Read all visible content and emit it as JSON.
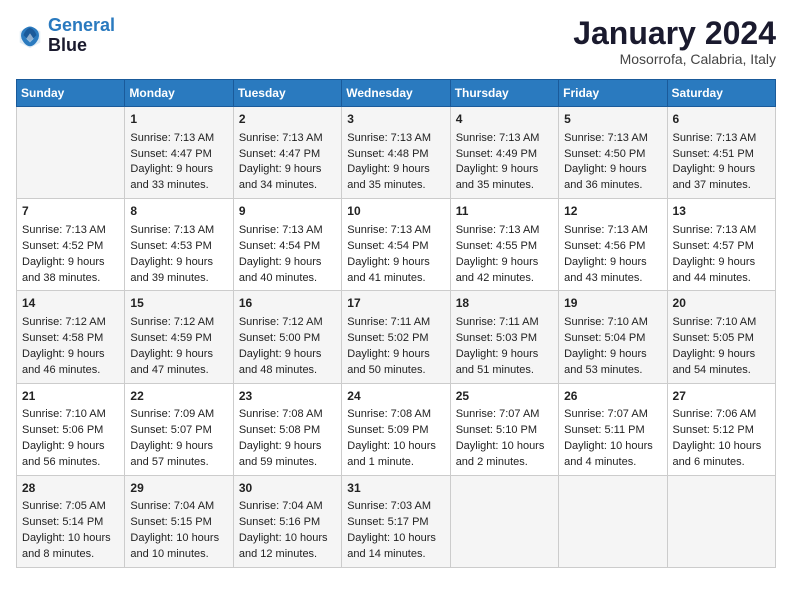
{
  "header": {
    "logo_line1": "General",
    "logo_line2": "Blue",
    "month": "January 2024",
    "location": "Mosorrofa, Calabria, Italy"
  },
  "columns": [
    "Sunday",
    "Monday",
    "Tuesday",
    "Wednesday",
    "Thursday",
    "Friday",
    "Saturday"
  ],
  "weeks": [
    [
      {
        "day": "",
        "sunrise": "",
        "sunset": "",
        "daylight": ""
      },
      {
        "day": "1",
        "sunrise": "Sunrise: 7:13 AM",
        "sunset": "Sunset: 4:47 PM",
        "daylight": "Daylight: 9 hours and 33 minutes."
      },
      {
        "day": "2",
        "sunrise": "Sunrise: 7:13 AM",
        "sunset": "Sunset: 4:47 PM",
        "daylight": "Daylight: 9 hours and 34 minutes."
      },
      {
        "day": "3",
        "sunrise": "Sunrise: 7:13 AM",
        "sunset": "Sunset: 4:48 PM",
        "daylight": "Daylight: 9 hours and 35 minutes."
      },
      {
        "day": "4",
        "sunrise": "Sunrise: 7:13 AM",
        "sunset": "Sunset: 4:49 PM",
        "daylight": "Daylight: 9 hours and 35 minutes."
      },
      {
        "day": "5",
        "sunrise": "Sunrise: 7:13 AM",
        "sunset": "Sunset: 4:50 PM",
        "daylight": "Daylight: 9 hours and 36 minutes."
      },
      {
        "day": "6",
        "sunrise": "Sunrise: 7:13 AM",
        "sunset": "Sunset: 4:51 PM",
        "daylight": "Daylight: 9 hours and 37 minutes."
      }
    ],
    [
      {
        "day": "7",
        "sunrise": "Sunrise: 7:13 AM",
        "sunset": "Sunset: 4:52 PM",
        "daylight": "Daylight: 9 hours and 38 minutes."
      },
      {
        "day": "8",
        "sunrise": "Sunrise: 7:13 AM",
        "sunset": "Sunset: 4:53 PM",
        "daylight": "Daylight: 9 hours and 39 minutes."
      },
      {
        "day": "9",
        "sunrise": "Sunrise: 7:13 AM",
        "sunset": "Sunset: 4:54 PM",
        "daylight": "Daylight: 9 hours and 40 minutes."
      },
      {
        "day": "10",
        "sunrise": "Sunrise: 7:13 AM",
        "sunset": "Sunset: 4:54 PM",
        "daylight": "Daylight: 9 hours and 41 minutes."
      },
      {
        "day": "11",
        "sunrise": "Sunrise: 7:13 AM",
        "sunset": "Sunset: 4:55 PM",
        "daylight": "Daylight: 9 hours and 42 minutes."
      },
      {
        "day": "12",
        "sunrise": "Sunrise: 7:13 AM",
        "sunset": "Sunset: 4:56 PM",
        "daylight": "Daylight: 9 hours and 43 minutes."
      },
      {
        "day": "13",
        "sunrise": "Sunrise: 7:13 AM",
        "sunset": "Sunset: 4:57 PM",
        "daylight": "Daylight: 9 hours and 44 minutes."
      }
    ],
    [
      {
        "day": "14",
        "sunrise": "Sunrise: 7:12 AM",
        "sunset": "Sunset: 4:58 PM",
        "daylight": "Daylight: 9 hours and 46 minutes."
      },
      {
        "day": "15",
        "sunrise": "Sunrise: 7:12 AM",
        "sunset": "Sunset: 4:59 PM",
        "daylight": "Daylight: 9 hours and 47 minutes."
      },
      {
        "day": "16",
        "sunrise": "Sunrise: 7:12 AM",
        "sunset": "Sunset: 5:00 PM",
        "daylight": "Daylight: 9 hours and 48 minutes."
      },
      {
        "day": "17",
        "sunrise": "Sunrise: 7:11 AM",
        "sunset": "Sunset: 5:02 PM",
        "daylight": "Daylight: 9 hours and 50 minutes."
      },
      {
        "day": "18",
        "sunrise": "Sunrise: 7:11 AM",
        "sunset": "Sunset: 5:03 PM",
        "daylight": "Daylight: 9 hours and 51 minutes."
      },
      {
        "day": "19",
        "sunrise": "Sunrise: 7:10 AM",
        "sunset": "Sunset: 5:04 PM",
        "daylight": "Daylight: 9 hours and 53 minutes."
      },
      {
        "day": "20",
        "sunrise": "Sunrise: 7:10 AM",
        "sunset": "Sunset: 5:05 PM",
        "daylight": "Daylight: 9 hours and 54 minutes."
      }
    ],
    [
      {
        "day": "21",
        "sunrise": "Sunrise: 7:10 AM",
        "sunset": "Sunset: 5:06 PM",
        "daylight": "Daylight: 9 hours and 56 minutes."
      },
      {
        "day": "22",
        "sunrise": "Sunrise: 7:09 AM",
        "sunset": "Sunset: 5:07 PM",
        "daylight": "Daylight: 9 hours and 57 minutes."
      },
      {
        "day": "23",
        "sunrise": "Sunrise: 7:08 AM",
        "sunset": "Sunset: 5:08 PM",
        "daylight": "Daylight: 9 hours and 59 minutes."
      },
      {
        "day": "24",
        "sunrise": "Sunrise: 7:08 AM",
        "sunset": "Sunset: 5:09 PM",
        "daylight": "Daylight: 10 hours and 1 minute."
      },
      {
        "day": "25",
        "sunrise": "Sunrise: 7:07 AM",
        "sunset": "Sunset: 5:10 PM",
        "daylight": "Daylight: 10 hours and 2 minutes."
      },
      {
        "day": "26",
        "sunrise": "Sunrise: 7:07 AM",
        "sunset": "Sunset: 5:11 PM",
        "daylight": "Daylight: 10 hours and 4 minutes."
      },
      {
        "day": "27",
        "sunrise": "Sunrise: 7:06 AM",
        "sunset": "Sunset: 5:12 PM",
        "daylight": "Daylight: 10 hours and 6 minutes."
      }
    ],
    [
      {
        "day": "28",
        "sunrise": "Sunrise: 7:05 AM",
        "sunset": "Sunset: 5:14 PM",
        "daylight": "Daylight: 10 hours and 8 minutes."
      },
      {
        "day": "29",
        "sunrise": "Sunrise: 7:04 AM",
        "sunset": "Sunset: 5:15 PM",
        "daylight": "Daylight: 10 hours and 10 minutes."
      },
      {
        "day": "30",
        "sunrise": "Sunrise: 7:04 AM",
        "sunset": "Sunset: 5:16 PM",
        "daylight": "Daylight: 10 hours and 12 minutes."
      },
      {
        "day": "31",
        "sunrise": "Sunrise: 7:03 AM",
        "sunset": "Sunset: 5:17 PM",
        "daylight": "Daylight: 10 hours and 14 minutes."
      },
      {
        "day": "",
        "sunrise": "",
        "sunset": "",
        "daylight": ""
      },
      {
        "day": "",
        "sunrise": "",
        "sunset": "",
        "daylight": ""
      },
      {
        "day": "",
        "sunrise": "",
        "sunset": "",
        "daylight": ""
      }
    ]
  ]
}
